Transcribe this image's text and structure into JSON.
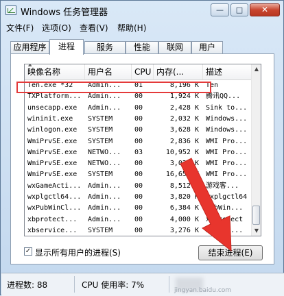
{
  "window": {
    "title": "Windows 任务管理器"
  },
  "titlebar": {
    "minimize": "—",
    "maximize": "□",
    "close": "✕"
  },
  "menu": [
    "文件(F)",
    "选项(O)",
    "查看(V)",
    "帮助(H)"
  ],
  "tabs": [
    "应用程序",
    "进程",
    "服务",
    "性能",
    "联网",
    "用户"
  ],
  "active_tab": "进程",
  "columns": [
    "映像名称",
    "用户名",
    "CPU",
    "内存(...",
    "描述"
  ],
  "rows": [
    {
      "name": "Ten.exe *32",
      "user": "Admin...",
      "cpu": "01",
      "mem": "8,196 K",
      "desc": "Ten"
    },
    {
      "name": "TXPlatform...",
      "user": "Admin...",
      "cpu": "00",
      "mem": "1,924 K",
      "desc": "腾讯QQ..."
    },
    {
      "name": "unsecapp.exe",
      "user": "Admin...",
      "cpu": "00",
      "mem": "2,428 K",
      "desc": "Sink to..."
    },
    {
      "name": "wininit.exe",
      "user": "SYSTEM",
      "cpu": "00",
      "mem": "2,032 K",
      "desc": "Windows..."
    },
    {
      "name": "winlogon.exe",
      "user": "SYSTEM",
      "cpu": "00",
      "mem": "3,628 K",
      "desc": "Windows..."
    },
    {
      "name": "WmiPrvSE.exe",
      "user": "SYSTEM",
      "cpu": "00",
      "mem": "2,836 K",
      "desc": "WMI Pro..."
    },
    {
      "name": "WmiPrvSE.exe",
      "user": "NETWO...",
      "cpu": "03",
      "mem": "10,952 K",
      "desc": "WMI Pro..."
    },
    {
      "name": "WmiPrvSE.exe",
      "user": "NETWO...",
      "cpu": "00",
      "mem": "3,028 K",
      "desc": "WMI Pro..."
    },
    {
      "name": "WmiPrvSE.exe",
      "user": "SYSTEM",
      "cpu": "00",
      "mem": "16,652 K",
      "desc": "WMI Pro..."
    },
    {
      "name": "wxGameActi...",
      "user": "Admin...",
      "cpu": "00",
      "mem": "8,512 K",
      "desc": "游戏客..."
    },
    {
      "name": "wxplgctl64...",
      "user": "Admin...",
      "cpu": "00",
      "mem": "3,820 K",
      "desc": "wxplgctl64"
    },
    {
      "name": "wxPubWinCl...",
      "user": "Admin...",
      "cpu": "00",
      "mem": "6,384 K",
      "desc": "PubWin..."
    },
    {
      "name": "xbprotect...",
      "user": "Admin...",
      "cpu": "00",
      "mem": "4,000 K",
      "desc": "xbprotect"
    },
    {
      "name": "xbservice...",
      "user": "SYSTEM",
      "cpu": "00",
      "mem": "3,276 K",
      "desc": "xbserv..."
    }
  ],
  "show_all_users": {
    "label": "显示所有用户的进程(S)",
    "checked": true
  },
  "end_process_label": "结束进程(E)",
  "status": {
    "processes": "进程数: 88",
    "cpu": "CPU 使用率: 7%"
  },
  "watermark": "jingyan.baidu.com",
  "colors": {
    "highlight": "#e43a3a",
    "arrow": "#e8352d"
  }
}
